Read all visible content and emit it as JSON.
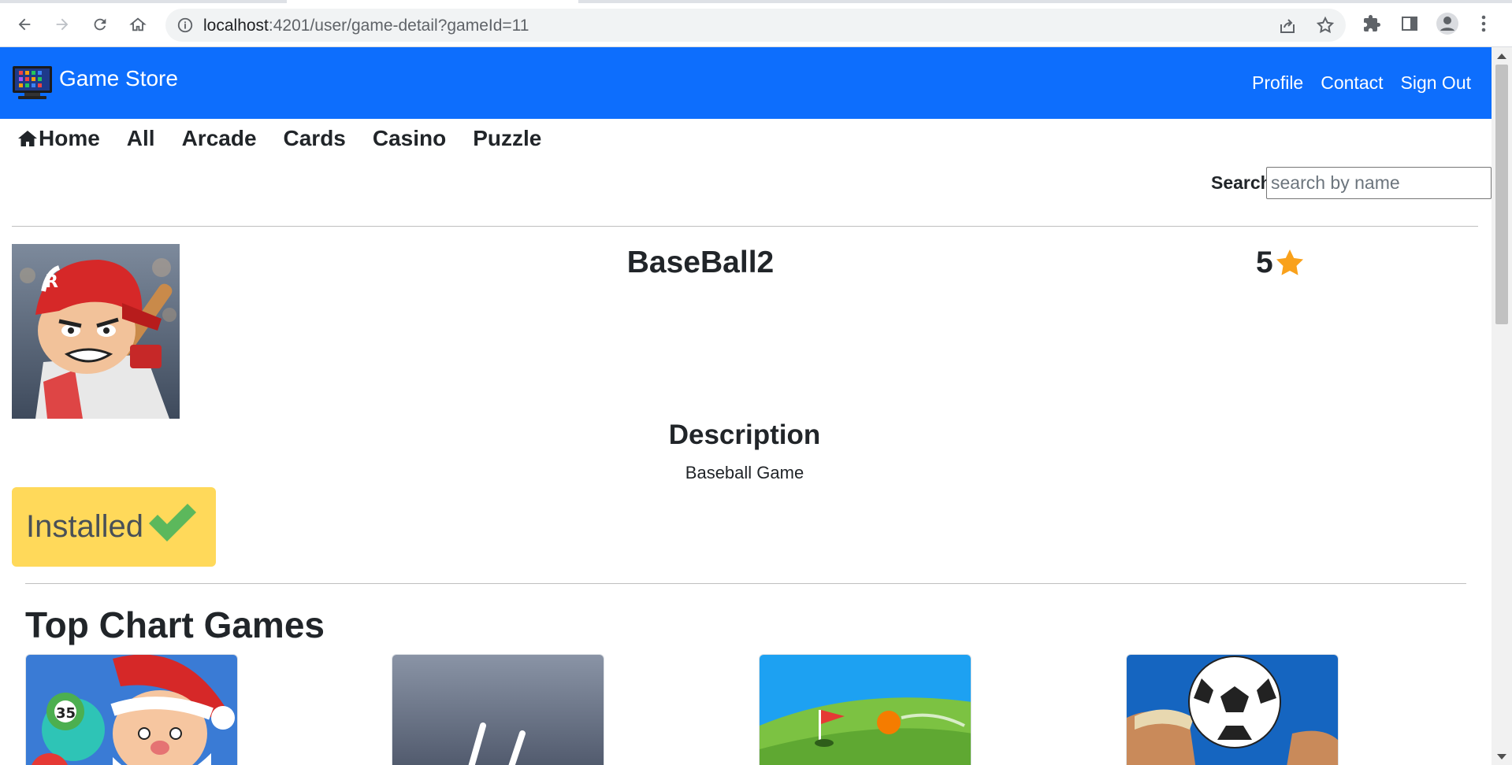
{
  "browser": {
    "url_host": "localhost",
    "url_rest": ":4201/user/game-detail?gameId=11"
  },
  "navbar": {
    "brand": "Game Store",
    "links": [
      "Profile",
      "Contact",
      "Sign Out"
    ]
  },
  "categories": [
    "Home",
    "All",
    "Arcade",
    "Cards",
    "Casino",
    "Puzzle"
  ],
  "search": {
    "label": "Search",
    "placeholder": "search by name",
    "value": ""
  },
  "game": {
    "title": "BaseBall2",
    "rating": "5",
    "description_heading": "Description",
    "description": "Baseball Game",
    "status": "Installed"
  },
  "top_chart": {
    "heading": "Top Chart Games"
  },
  "colors": {
    "navbar": "#0d6efd",
    "installed_bg": "#ffd95a",
    "check": "#5cb85c",
    "star": "#f9a11b"
  }
}
